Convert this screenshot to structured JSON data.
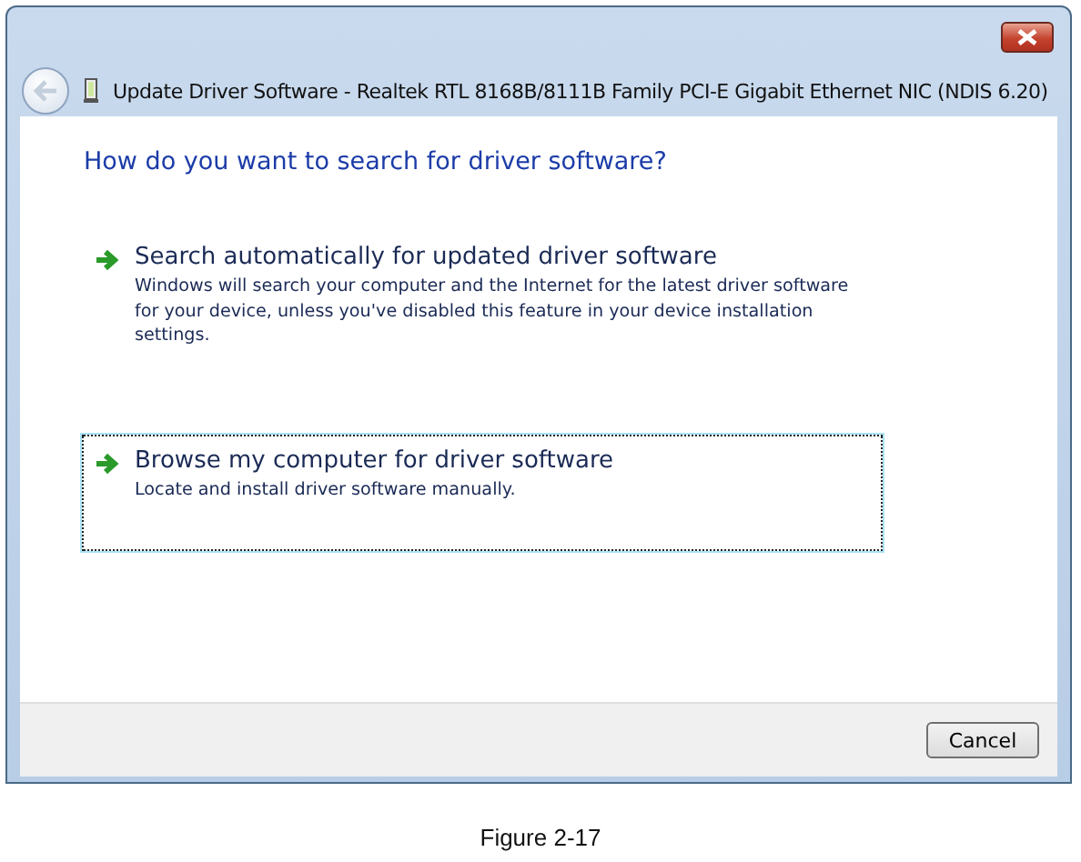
{
  "window": {
    "title": "Update Driver Software - Realtek RTL 8168B/8111B Family PCI-E Gigabit Ethernet NIC (NDIS 6.20)"
  },
  "heading": "How do you want to search for driver software?",
  "options": [
    {
      "title": "Search automatically for updated driver software",
      "description": "Windows will search your computer and the Internet for the latest driver software for your device, unless you've disabled this feature in your device installation settings.",
      "selected": false
    },
    {
      "title": "Browse my computer for driver software",
      "description": "Locate and install driver software manually.",
      "selected": true
    }
  ],
  "buttons": [
    {
      "label": "Cancel"
    }
  ],
  "caption": "Figure 2-17"
}
